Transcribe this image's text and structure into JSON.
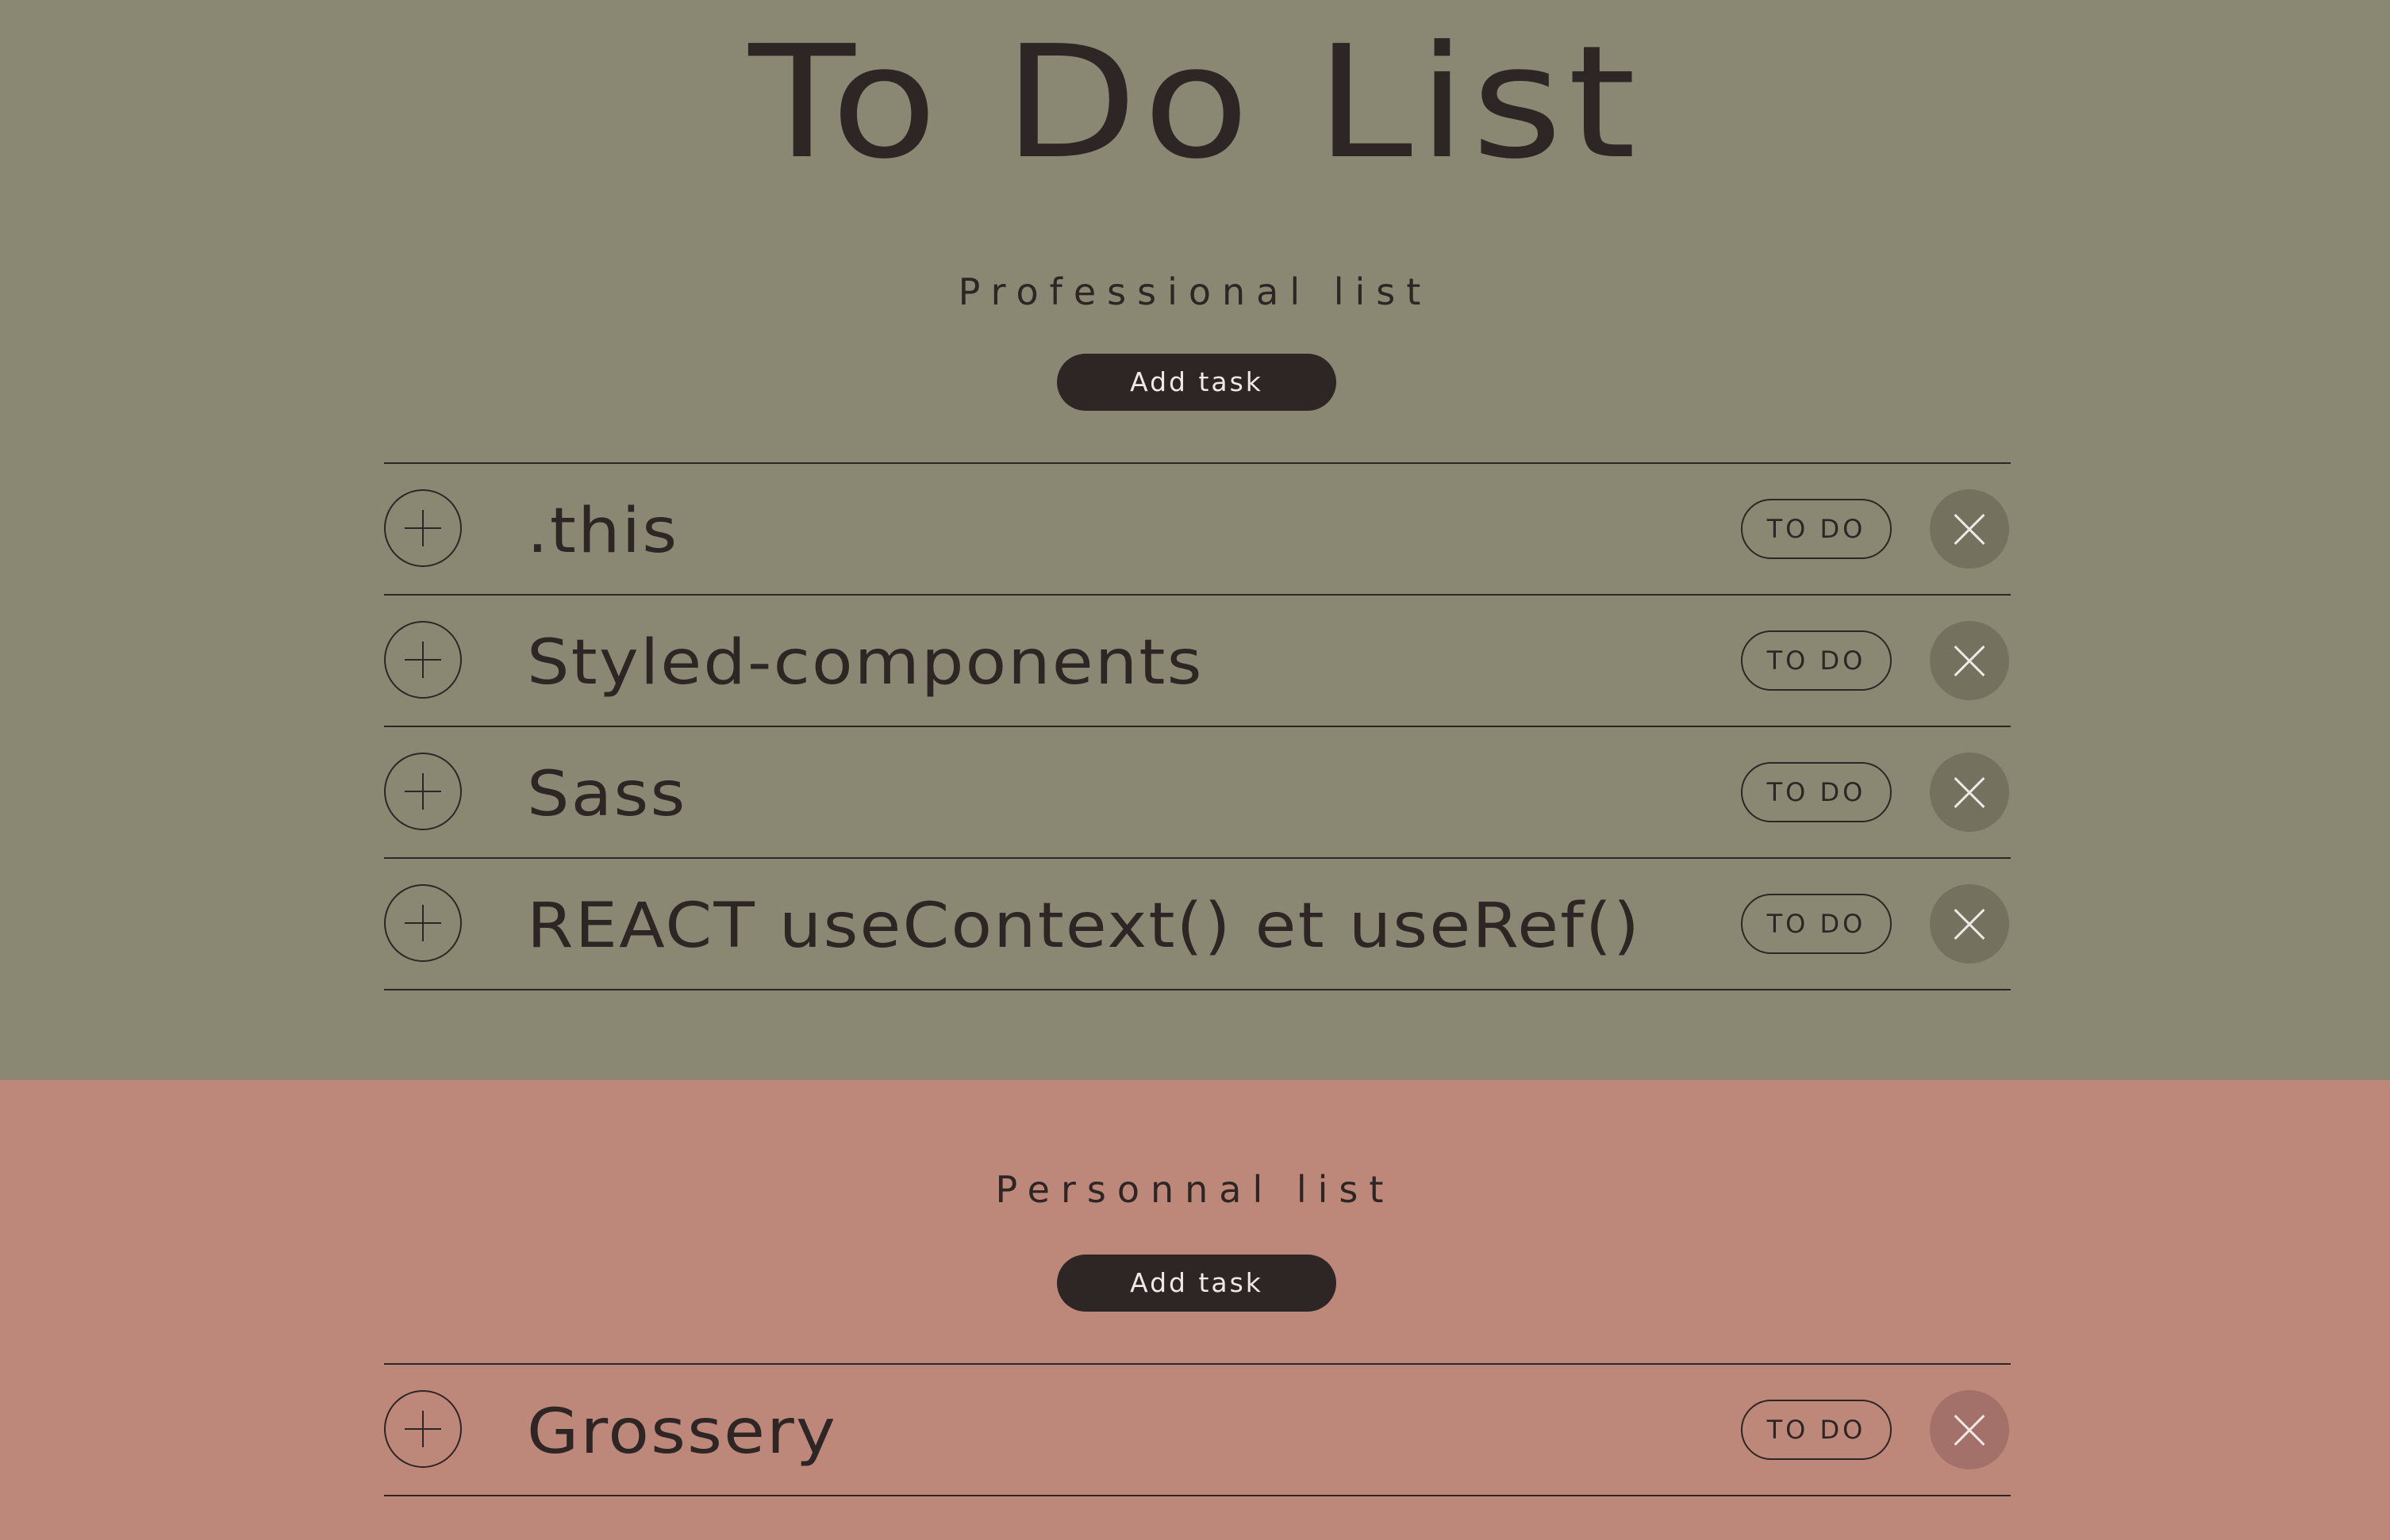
{
  "app": {
    "title": "To Do List"
  },
  "colors": {
    "professional_bg": "#8a8873",
    "personal_bg": "#bd8779",
    "text": "#2e2624",
    "button_bg": "#2e2624",
    "button_text": "#efe9e4",
    "professional_delete_bg": "#74715e",
    "personal_delete_bg": "#a4716a"
  },
  "lists": [
    {
      "title": "Professional list",
      "add_label": "Add task",
      "tasks": [
        {
          "label": ".this",
          "status": "TO DO",
          "add_icon": "plus-icon",
          "delete_icon": "close-icon"
        },
        {
          "label": "Styled-components",
          "status": "TO DO",
          "add_icon": "plus-icon",
          "delete_icon": "close-icon"
        },
        {
          "label": "Sass",
          "status": "TO DO",
          "add_icon": "plus-icon",
          "delete_icon": "close-icon"
        },
        {
          "label": "REACT useContext() et useRef()",
          "status": "TO DO",
          "add_icon": "plus-icon",
          "delete_icon": "close-icon"
        }
      ]
    },
    {
      "title": "Personnal list",
      "add_label": "Add task",
      "tasks": [
        {
          "label": "Grossery",
          "status": "TO DO",
          "add_icon": "plus-icon",
          "delete_icon": "close-icon"
        }
      ]
    }
  ]
}
